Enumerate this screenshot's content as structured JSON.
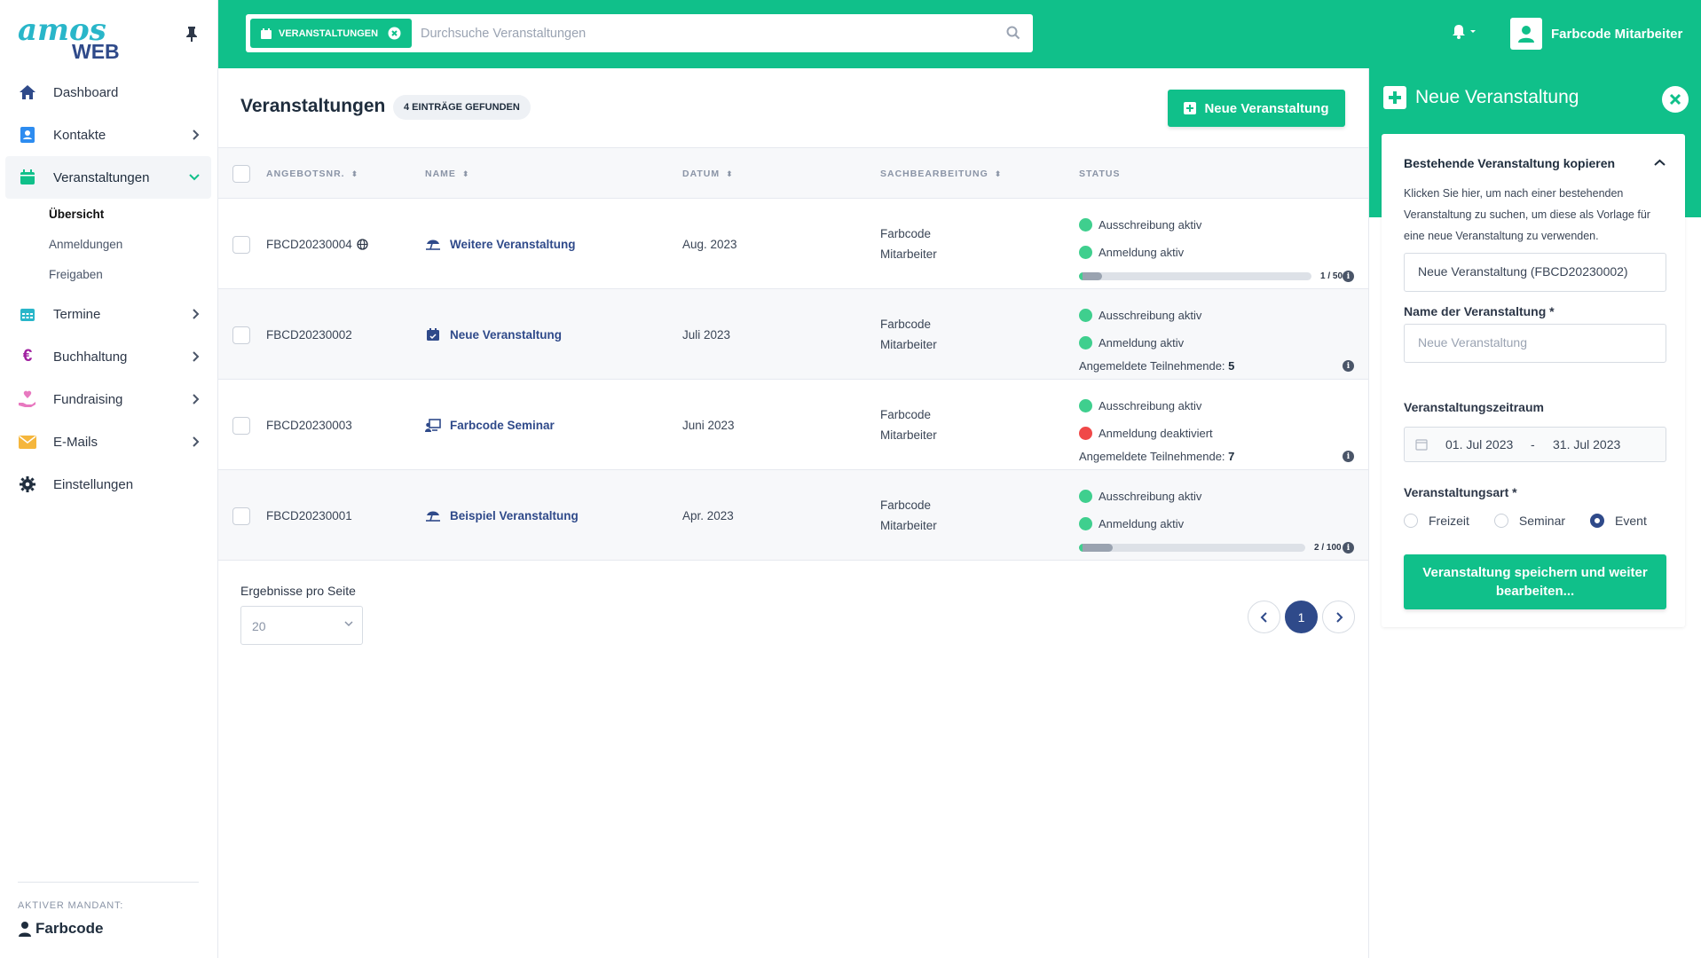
{
  "brand": {
    "logo_top": "amos",
    "logo_bottom": "WEB",
    "accent": "#10c08a",
    "navy": "#2f4a8a"
  },
  "sidebar": {
    "items": [
      {
        "label": "Dashboard",
        "icon": "home-icon"
      },
      {
        "label": "Kontakte",
        "icon": "contact-card-icon"
      },
      {
        "label": "Veranstaltungen",
        "icon": "calendar-icon"
      },
      {
        "label": "Termine",
        "icon": "calendar-grid-icon"
      },
      {
        "label": "Buchhaltung",
        "icon": "euro-icon"
      },
      {
        "label": "Fundraising",
        "icon": "hand-heart-icon"
      },
      {
        "label": "E-Mails",
        "icon": "envelope-icon"
      },
      {
        "label": "Einstellungen",
        "icon": "gear-icon"
      }
    ],
    "sub_items": [
      "Übersicht",
      "Anmeldungen",
      "Freigaben"
    ],
    "mandant_label": "AKTIVER MANDANT:",
    "mandant_name": "Farbcode"
  },
  "topbar": {
    "search_tag": "VERANSTALTUNGEN",
    "search_placeholder": "Durchsuche Veranstaltungen",
    "user_name": "Farbcode Mitarbeiter"
  },
  "main": {
    "title": "Veranstaltungen",
    "count_badge": "4 EINTRÄGE GEFUNDEN",
    "new_button": "Neue Veranstaltung",
    "columns": [
      "ANGEBOTSNR.",
      "NAME",
      "DATUM",
      "SACHBEARBEITUNG",
      "STATUS"
    ],
    "rows": [
      {
        "nr": "FBCD20230004",
        "name": "Weitere Veranstaltung",
        "date": "Aug. 2023",
        "sb1": "Farbcode",
        "sb2": "Mitarbeiter",
        "status1": "Ausschreibung aktiv",
        "status2": "Anmeldung aktiv",
        "progress_label": "1 / 50",
        "progress": 0.1
      },
      {
        "nr": "FBCD20230002",
        "name": "Neue Veranstaltung",
        "date": "Juli 2023",
        "sb1": "Farbcode",
        "sb2": "Mitarbeiter",
        "status1": "Ausschreibung aktiv",
        "status2": "Anmeldung aktiv",
        "tn_label": "Angemeldete Teilnehmende:",
        "tn_value": "5"
      },
      {
        "nr": "FBCD20230003",
        "name": "Farbcode Seminar",
        "date": "Juni 2023",
        "sb1": "Farbcode",
        "sb2": "Mitarbeiter",
        "status1": "Ausschreibung aktiv",
        "status2": "Anmeldung deaktiviert",
        "tn_label": "Angemeldete Teilnehmende:",
        "tn_value": "7"
      },
      {
        "nr": "FBCD20230001",
        "name": "Beispiel Veranstaltung",
        "date": "Apr. 2023",
        "sb1": "Farbcode",
        "sb2": "Mitarbeiter",
        "status1": "Ausschreibung aktiv",
        "status2": "Anmeldung aktiv",
        "progress_label": "2 / 100",
        "progress": 0.15
      }
    ],
    "per_page_label": "Ergebnisse pro Seite",
    "per_page_value": "20",
    "current_page": "1"
  },
  "panel": {
    "title": "Neue Veranstaltung",
    "copy_title": "Bestehende Veranstaltung kopieren",
    "copy_desc": "Klicken Sie hier, um nach einer bestehenden Veranstaltung zu suchen, um diese als Vorlage für eine neue Veranstaltung zu verwenden.",
    "copy_value": "Neue Veranstaltung (FBCD20230002)",
    "name_label": "Name der Veranstaltung *",
    "name_placeholder": "Neue Veranstaltung",
    "range_label": "Veranstaltungszeitraum",
    "date_from": "01. Jul 2023",
    "date_sep": "-",
    "date_to": "31. Jul 2023",
    "type_label": "Veranstaltungsart *",
    "types": [
      "Freizeit",
      "Seminar",
      "Event"
    ],
    "selected_type": "Event",
    "save_button": "Veranstaltung speichern und weiter bearbeiten..."
  }
}
